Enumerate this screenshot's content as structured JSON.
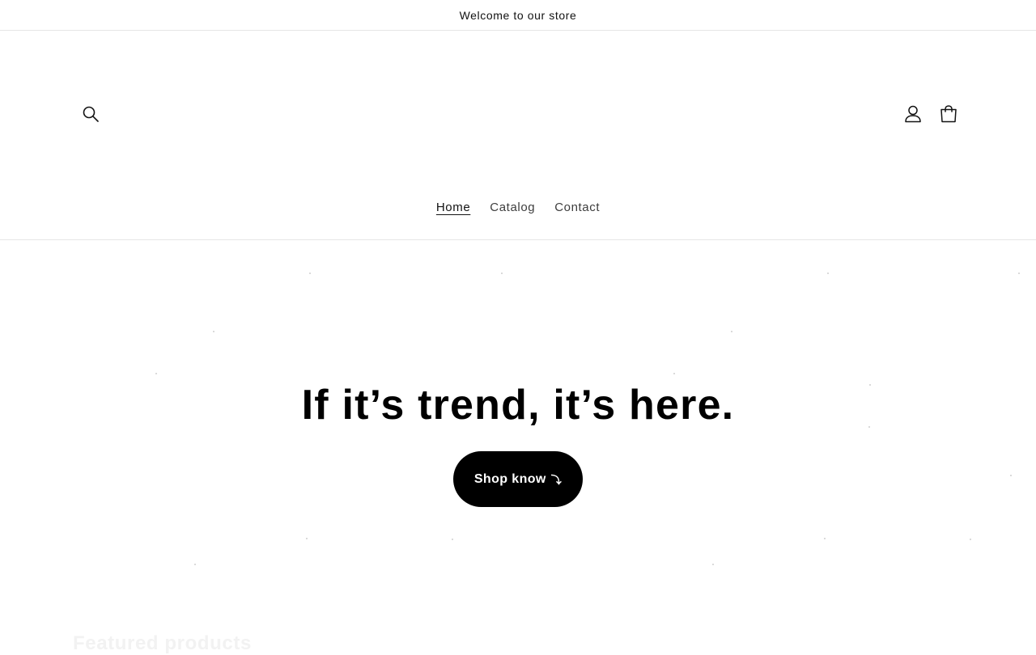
{
  "announcement": {
    "text": "Welcome to our store"
  },
  "header": {
    "icons": {
      "search": "search-icon",
      "account": "account-icon",
      "cart": "cart-icon"
    }
  },
  "nav": {
    "items": [
      {
        "label": "Home",
        "active": true
      },
      {
        "label": "Catalog",
        "active": false
      },
      {
        "label": "Contact",
        "active": false
      }
    ]
  },
  "hero": {
    "title": "If it’s trend, it’s here.",
    "button_label": "Shop know",
    "button_arrow": "⤵"
  },
  "featured": {
    "heading": "Featured products"
  },
  "colors": {
    "primary": "#000000",
    "background": "#ffffff",
    "text": "#121212",
    "border": "#e6e6e6"
  }
}
